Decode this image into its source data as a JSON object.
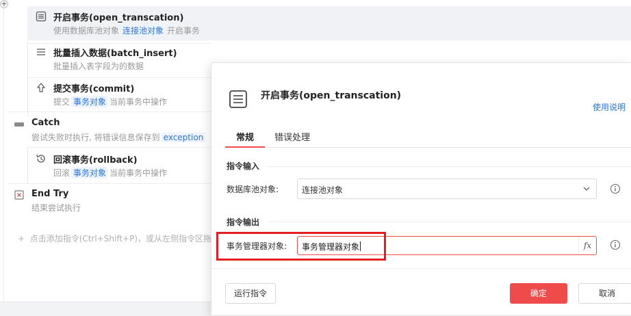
{
  "flow": {
    "steps": [
      {
        "title": "开启事务(open_transcation)",
        "desc_pre": "使用数据库池对象",
        "desc_chip": "连接池对象",
        "desc_post": "开启事务",
        "icon": "list-icon"
      },
      {
        "title": "批量插入数据(batch_insert)",
        "desc_pre": "批量插入表字段为的数据",
        "icon": "lines-icon"
      },
      {
        "title": "提交事务(commit)",
        "desc_pre": "提交",
        "desc_chip": "事务对象",
        "desc_post": "当前事务中操作",
        "icon": "arrow-up-icon"
      },
      {
        "title": "Catch",
        "desc_pre": "尝试失败时执行, 将错误信息保存到",
        "desc_chip": "exception",
        "icon": "catch-icon"
      },
      {
        "title": "回滚事务(rollback)",
        "desc_pre": "回滚",
        "desc_chip": "事务对象",
        "desc_post": "当前事务中操作",
        "icon": "history-icon"
      },
      {
        "title": "End Try",
        "desc_pre": "结束尝试执行",
        "icon": "end-try-icon"
      }
    ],
    "add_hint": "点击添加指令(Ctrl+Shift+P)，或从左侧指令区拖入"
  },
  "dialog": {
    "title": "开启事务(open_transcation)",
    "help_link": "使用说明",
    "tabs": [
      {
        "label": "常规",
        "active": true
      },
      {
        "label": "错误处理",
        "active": false
      }
    ],
    "input_section_title": "指令输入",
    "pool_label": "数据库池对象:",
    "pool_value": "连接池对象",
    "output_section_title": "指令输出",
    "manager_label": "事务管理器对象:",
    "manager_value": "事务管理器对象",
    "fx_label": "fx",
    "run_button": "运行指令",
    "ok_button": "确定",
    "cancel_button": "取消"
  },
  "colors": {
    "accent_red": "#f04b4b",
    "link_blue": "#2e74d9",
    "highlight_red": "#e51c23"
  }
}
